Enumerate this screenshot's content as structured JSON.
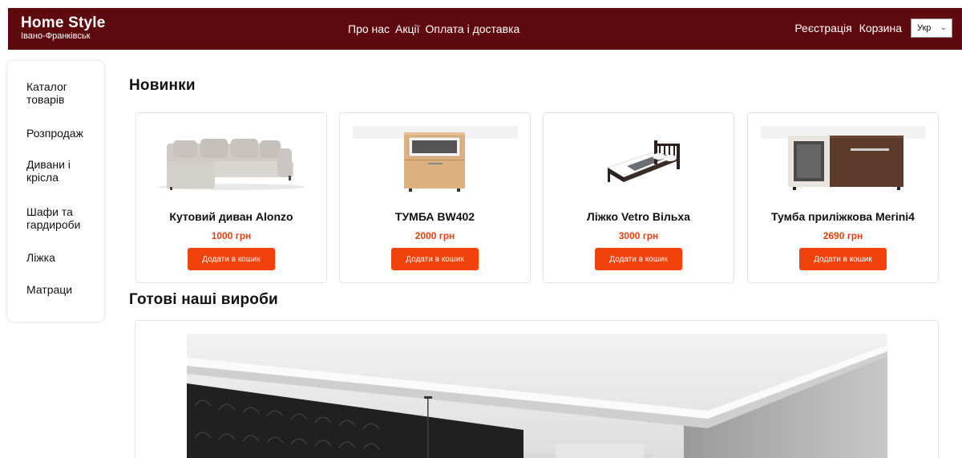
{
  "header": {
    "brand_name": "Home Style",
    "brand_city": "Івано-Франківськ",
    "nav": [
      "Про нас",
      "Акції",
      "Оплата і доставка"
    ],
    "register": "Реєстрація",
    "cart": "Корзина",
    "language": "Укр"
  },
  "sidebar": {
    "items": [
      "Каталог товарів",
      "Розпродаж",
      "Дивани і крісла",
      "Шафи та гардироби",
      "Ліжка",
      "Матраци"
    ]
  },
  "sections": {
    "new_title": "Новинки",
    "works_title": "Готові наші вироби"
  },
  "products": [
    {
      "name": "Кутовий диван Alonzo",
      "price": "1000 грн",
      "button": "Додати в кошик",
      "icon": "sofa-icon"
    },
    {
      "name": "ТУМБА BW402",
      "price": "2000 грн",
      "button": "Додати в кошик",
      "icon": "nightstand-icon"
    },
    {
      "name": "Ліжко Vetro Вільха",
      "price": "3000 грн",
      "button": "Додати в кошик",
      "icon": "bed-icon"
    },
    {
      "name": "Тумба приліжкова Merini4",
      "price": "2690 грн",
      "button": "Додати в кошик",
      "icon": "cabinet-icon"
    }
  ],
  "colors": {
    "header_bg": "#5e0a0f",
    "accent": "#f1420c",
    "price": "#e5400f"
  }
}
